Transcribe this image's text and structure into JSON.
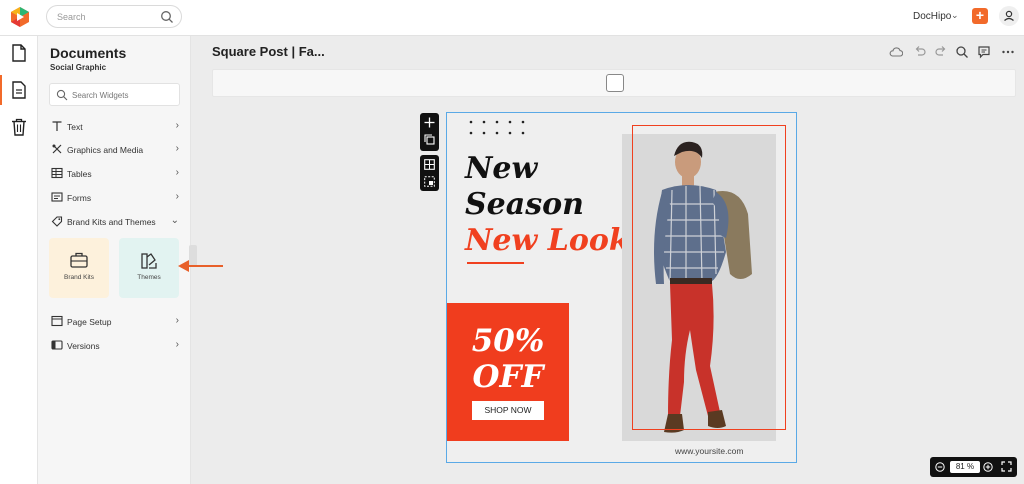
{
  "topbar": {
    "search_placeholder": "Search",
    "brand_name": "DocHipo",
    "brand_caret": "⌄",
    "add_label": "+"
  },
  "panel": {
    "title": "Documents",
    "subtitle": "Social Graphic",
    "widget_search_placeholder": "Search Widgets",
    "menu": [
      {
        "label": "Text",
        "icon": "text-icon",
        "chevron": "›"
      },
      {
        "label": "Graphics and Media",
        "icon": "graphics-icon",
        "chevron": "›"
      },
      {
        "label": "Tables",
        "icon": "table-icon",
        "chevron": "›"
      },
      {
        "label": "Forms",
        "icon": "forms-icon",
        "chevron": "›"
      },
      {
        "label": "Brand Kits and Themes",
        "icon": "brand-icon",
        "chevron": "⌄"
      },
      {
        "label": "Page Setup",
        "icon": "page-setup-icon",
        "chevron": "›"
      },
      {
        "label": "Versions",
        "icon": "versions-icon",
        "chevron": "›"
      }
    ],
    "tiles": [
      {
        "label": "Brand Kits",
        "bg": "#fdf1dc"
      },
      {
        "label": "Themes",
        "bg": "#e2f3f1"
      }
    ]
  },
  "editor": {
    "doc_title": "Square Post | Fa...",
    "zoom_value": "81",
    "zoom_unit": "%"
  },
  "design": {
    "line1": "New",
    "line2": "Season",
    "line3": "New Look",
    "discount": "50%",
    "discount_word": "OFF",
    "cta": "SHOP NOW",
    "website": "www.yoursite.com",
    "accent": "#f03d1e"
  },
  "colors": {
    "accent": "#f26a2a",
    "selection": "#5aa9e6"
  }
}
